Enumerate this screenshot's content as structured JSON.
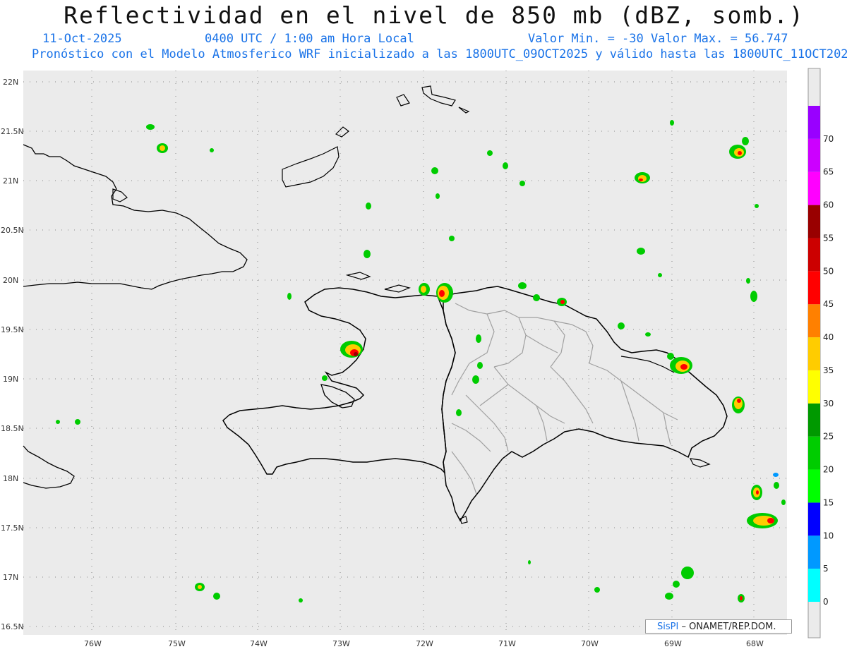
{
  "header": {
    "title": "Reflectividad en el nivel de 850 mb (dBZ, somb.)",
    "date": "11-Oct-2025",
    "time": "0400 UTC / 1:00 am Hora Local",
    "minmax": "Valor Min. = -30  Valor Max. = 56.747",
    "subtitle": "Pronóstico con el Modelo Atmosferico WRF inicializado a las 1800UTC_09OCT2025 y válido hasta las  1800UTC_11OCT2025"
  },
  "axes": {
    "lat_labels": [
      "22N",
      "21.5N",
      "21N",
      "20.5N",
      "20N",
      "19.5N",
      "19N",
      "18.5N",
      "18N",
      "17.5N",
      "17N",
      "16.5N"
    ],
    "lon_labels": [
      "76W",
      "75W",
      "74W",
      "73W",
      "72W",
      "71W",
      "70W",
      "69W",
      "68W"
    ]
  },
  "colorbar": {
    "labels": [
      "0",
      "5",
      "10",
      "15",
      "20",
      "25",
      "30",
      "35",
      "40",
      "45",
      "50",
      "55",
      "60",
      "65",
      "70"
    ],
    "colors": [
      "#00ffff",
      "#0099ff",
      "#0000ff",
      "#00ff00",
      "#00cc00",
      "#009900",
      "#ffff00",
      "#ffcc00",
      "#ff8000",
      "#ff0000",
      "#cc0000",
      "#990000",
      "#ff00ff",
      "#cc00ff",
      "#9900ff"
    ]
  },
  "credit": {
    "brand": "SisPI",
    "org": " – ONAMET/REP.DOM."
  },
  "colors": {
    "map_bg": "#ebebeb",
    "coast": "#000000",
    "provinces": "#a0a0a0",
    "header_blue": "#1a73e8"
  }
}
